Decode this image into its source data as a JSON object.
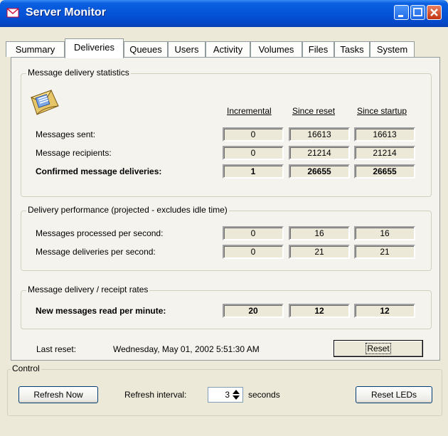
{
  "window": {
    "title": "Server Monitor"
  },
  "tabs": [
    {
      "label": "Summary"
    },
    {
      "label": "Deliveries"
    },
    {
      "label": "Queues"
    },
    {
      "label": "Users"
    },
    {
      "label": "Activity"
    },
    {
      "label": "Volumes"
    },
    {
      "label": "Files"
    },
    {
      "label": "Tasks"
    },
    {
      "label": "System"
    }
  ],
  "active_tab": "Deliveries",
  "stats_group": {
    "title": "Message delivery statistics",
    "columns": [
      "Incremental",
      "Since reset",
      "Since startup"
    ],
    "rows": [
      {
        "label": "Messages sent:",
        "values": [
          "0",
          "16613",
          "16613"
        ],
        "bold": false
      },
      {
        "label": "Message recipients:",
        "values": [
          "0",
          "21214",
          "21214"
        ],
        "bold": false
      },
      {
        "label": "Confirmed message deliveries:",
        "values": [
          "1",
          "26655",
          "26655"
        ],
        "bold": true
      }
    ]
  },
  "perf_group": {
    "title": "Delivery performance (projected - excludes idle time)",
    "rows": [
      {
        "label": "Messages processed per second:",
        "values": [
          "0",
          "16",
          "16"
        ]
      },
      {
        "label": "Message deliveries per second:",
        "values": [
          "0",
          "21",
          "21"
        ]
      }
    ]
  },
  "rates_group": {
    "title": "Message delivery / receipt rates",
    "rows": [
      {
        "label": "New messages read per minute:",
        "values": [
          "20",
          "12",
          "12"
        ]
      }
    ]
  },
  "last_reset": {
    "label": "Last reset:",
    "value": "Wednesday, May 01, 2002 5:51:30 AM"
  },
  "reset_button": "Reset",
  "control": {
    "title": "Control",
    "refresh_now": "Refresh Now",
    "interval_label": "Refresh interval:",
    "interval_value": "3",
    "interval_unit": "seconds",
    "reset_leds": "Reset LEDs"
  },
  "colors": {
    "titlebar": "#0554d8",
    "face": "#ece9d8",
    "close": "#c23310"
  }
}
